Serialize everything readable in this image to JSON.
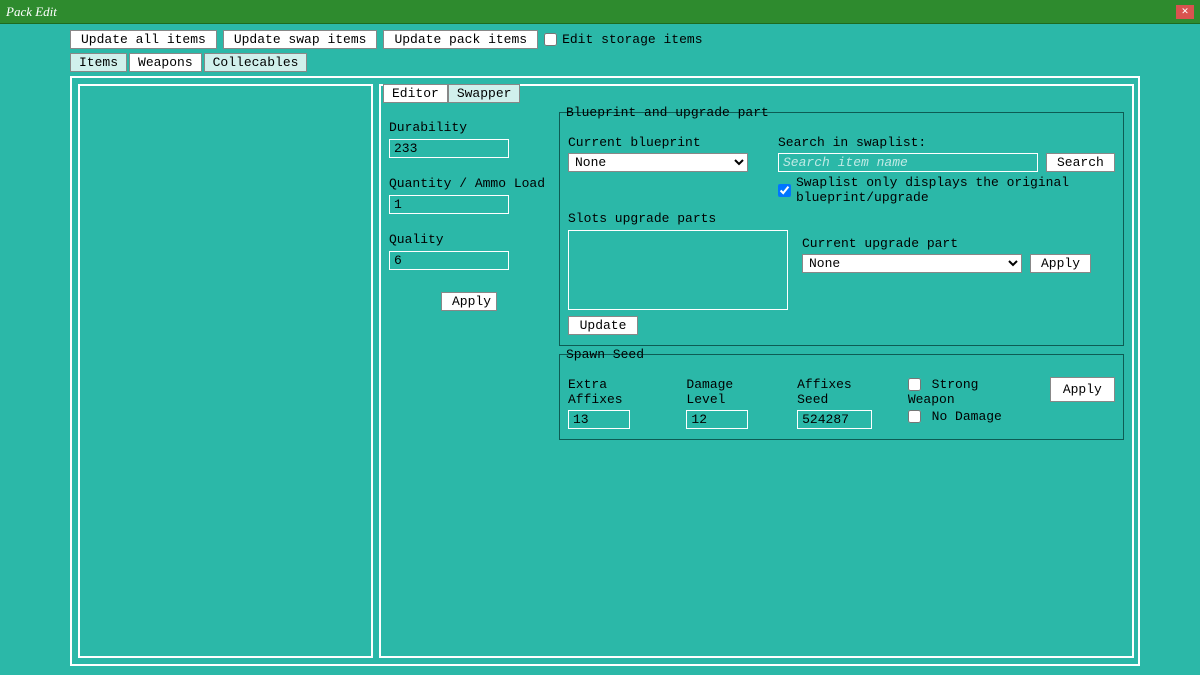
{
  "window": {
    "title": "Pack Edit"
  },
  "toolbar": {
    "update_all": "Update all items",
    "update_swap": "Update swap items",
    "update_pack": "Update pack items",
    "edit_storage_label": "Edit storage items"
  },
  "main_tabs": {
    "items": "Items",
    "weapons": "Weapons",
    "collecables": "Collecables"
  },
  "sub_tabs": {
    "editor": "Editor",
    "swapper": "Swapper"
  },
  "editor": {
    "durability_label": "Durability",
    "durability_value": "233",
    "quantity_label": "Quantity / Ammo Load",
    "quantity_value": "1",
    "quality_label": "Quality",
    "quality_value": "6",
    "apply": "Apply"
  },
  "blueprint": {
    "group_title": "Blueprint and upgrade part",
    "current_bp_label": "Current blueprint",
    "current_bp_value": "None",
    "search_label": "Search in swaplist:",
    "search_placeholder": "Search item name",
    "search_btn": "Search",
    "swaplist_checkbox": "Swaplist only displays the original blueprint/upgrade",
    "slots_label": "Slots upgrade parts",
    "current_upgrade_label": "Current upgrade part",
    "current_upgrade_value": "None",
    "apply": "Apply",
    "update": "Update"
  },
  "seed": {
    "group_title": "Spawn Seed",
    "extra_affixes_label": "Extra Affixes",
    "extra_affixes_value": "13",
    "damage_level_label": "Damage Level",
    "damage_level_value": "12",
    "affixes_seed_label": "Affixes Seed",
    "affixes_seed_value": "524287",
    "strong_weapon": "Strong Weapon",
    "no_damage": "No Damage",
    "apply": "Apply"
  }
}
